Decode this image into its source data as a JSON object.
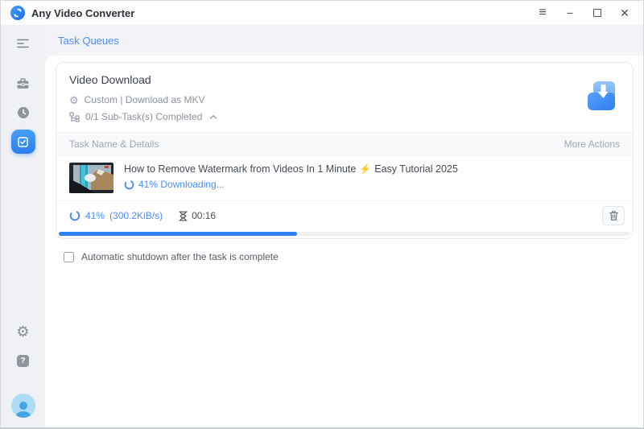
{
  "titlebar": {
    "app_name": "Any Video Converter"
  },
  "window_controls": {
    "menu": "≡",
    "minimize": "−",
    "close": "✕"
  },
  "nav": {
    "task_queues_label": "Task Queues"
  },
  "sidebar": {
    "icons": [
      "collapse-menu-icon",
      "toolbox-icon",
      "history-clock-icon",
      "task-queue-active-icon",
      "settings-gear-icon",
      "help-icon",
      "user-avatar"
    ],
    "gear_glyph": "⚙",
    "help_glyph": "?"
  },
  "card": {
    "title": "Video Download",
    "gear_glyph": "⚙",
    "profile_text": "Custom | Download as MKV",
    "subtask_text": "0/1 Sub-Task(s) Completed",
    "table_header_left": "Task Name & Details",
    "table_header_right": "More Actions"
  },
  "task": {
    "title_part1": "How to Remove Watermark from Videos In 1 Minute",
    "lightning": "⚡",
    "title_part2": "Easy Tutorial 2025",
    "status_text": "41% Downloading...",
    "percent": "41%",
    "speed": "(300.2KiB/s)",
    "eta": "00:16",
    "progress_style": "width:41.7%"
  },
  "footer": {
    "shutdown_label": "Automatic shutdown after the task is complete",
    "checked": false
  },
  "colors": {
    "accent_blue": "#4a8df6",
    "progress_fill": "#2e7ff2",
    "sidebar_active": "#2f8bf4",
    "avatar_bg": "#aedcf5",
    "avatar_fg": "#45a5e9",
    "lightning_orange": "#f6a623",
    "panel_bg": "#ffffff",
    "chrome_bg": "#f1f3f7"
  }
}
